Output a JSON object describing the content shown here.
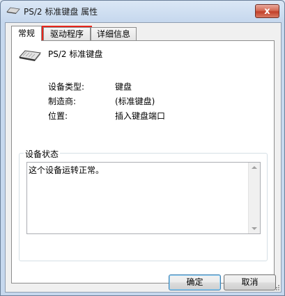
{
  "window": {
    "title": "PS/2 标准键盘 属性",
    "close_glyph": "x"
  },
  "tabs": [
    {
      "label": "常规",
      "active": true
    },
    {
      "label": "驱动程序",
      "active": false,
      "highlighted": true
    },
    {
      "label": "详细信息",
      "active": false
    }
  ],
  "device": {
    "name": "PS/2 标准键盘",
    "icon": "keyboard-icon",
    "properties": [
      {
        "key": "设备类型:",
        "value": "键盘"
      },
      {
        "key": "制造商:",
        "value": "(标准键盘)"
      },
      {
        "key": "位置:",
        "value": "插入键盘端口"
      }
    ]
  },
  "status": {
    "legend": "设备状态",
    "text": "这个设备运转正常。"
  },
  "buttons": {
    "ok": "确定",
    "cancel": "取消"
  },
  "colors": {
    "highlight_border": "#e8261b",
    "close_button": "#c2402a"
  }
}
